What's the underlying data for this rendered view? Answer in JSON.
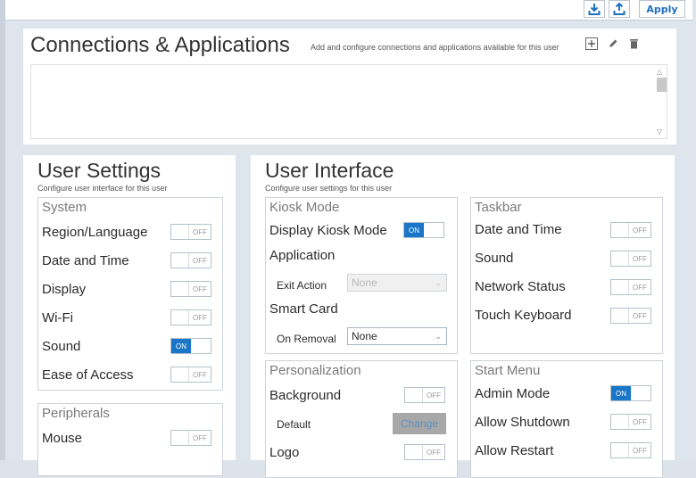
{
  "toolbar": {
    "download_icon": "download-icon",
    "upload_icon": "upload-icon",
    "apply_label": "Apply"
  },
  "connections": {
    "title": "Connections & Applications",
    "subtitle": "Add and configure connections and applications available for this user"
  },
  "user_settings": {
    "title": "User Settings",
    "subtitle": "Configure user interface for this user",
    "system": {
      "title": "System",
      "items": [
        {
          "label": "Region/Language",
          "state": "OFF"
        },
        {
          "label": "Date and Time",
          "state": "OFF"
        },
        {
          "label": "Display",
          "state": "OFF"
        },
        {
          "label": "Wi-Fi",
          "state": "OFF"
        },
        {
          "label": "Sound",
          "state": "ON"
        },
        {
          "label": "Ease of Access",
          "state": "OFF"
        }
      ]
    },
    "peripherals": {
      "title": "Peripherals",
      "items": [
        {
          "label": "Mouse",
          "state": "OFF"
        }
      ]
    }
  },
  "user_interface": {
    "title": "User Interface",
    "subtitle": "Configure user settings for this user",
    "kiosk": {
      "title": "Kiosk Mode",
      "display_kiosk_label": "Display Kiosk Mode",
      "display_kiosk_state": "ON",
      "application_label": "Application",
      "exit_action_label": "Exit Action",
      "exit_action_value": "None",
      "smart_card_label": "Smart Card",
      "on_removal_label": "On Removal",
      "on_removal_value": "None"
    },
    "taskbar": {
      "title": "Taskbar",
      "items": [
        {
          "label": "Date and Time",
          "state": "OFF"
        },
        {
          "label": "Sound",
          "state": "OFF"
        },
        {
          "label": "Network Status",
          "state": "OFF"
        },
        {
          "label": "Touch Keyboard",
          "state": "OFF"
        }
      ]
    },
    "personalization": {
      "title": "Personalization",
      "background_label": "Background",
      "background_state": "OFF",
      "default_label": "Default",
      "change_label": "Change",
      "logo_label": "Logo",
      "logo_state": "OFF"
    },
    "start_menu": {
      "title": "Start Menu",
      "items": [
        {
          "label": "Admin Mode",
          "state": "ON"
        },
        {
          "label": "Allow Shutdown",
          "state": "OFF"
        },
        {
          "label": "Allow Restart",
          "state": "OFF"
        }
      ]
    }
  },
  "colors": {
    "accent": "#1976c8",
    "background": "#dfe5ec",
    "panel": "#ffffff"
  }
}
